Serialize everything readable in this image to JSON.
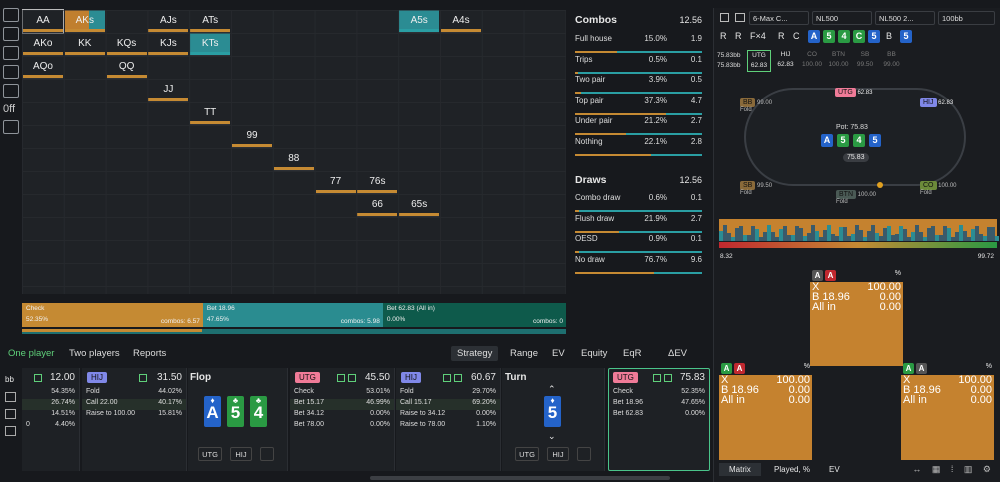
{
  "left_toolbar": {
    "icons": [
      "grid-icon",
      "copy-icon",
      "cards-icon",
      "chat-icon",
      "layout-icon",
      "0ff-icon",
      "message-icon"
    ],
    "zero_label": "0ff"
  },
  "matrix": {
    "cells": [
      {
        "label": "AA",
        "col": 0,
        "row": 0,
        "color": "#1f2226",
        "bar": "#c58a33",
        "selected": true
      },
      {
        "label": "AKs",
        "col": 1,
        "row": 0,
        "color": "#c07f2f",
        "bar": "#c58a33",
        "color2": "#2b8c93"
      },
      {
        "label": "AJs",
        "col": 3,
        "row": 0,
        "bar": "#c58a33"
      },
      {
        "label": "ATs",
        "col": 4,
        "row": 0,
        "bar": "#c58a33"
      },
      {
        "label": "A5s",
        "col": 9,
        "row": 0,
        "color": "#2b8c93",
        "bar": "#2a9ea3"
      },
      {
        "label": "A4s",
        "col": 10,
        "row": 0,
        "bar": "#c58a33"
      },
      {
        "label": "AKo",
        "col": 0,
        "row": 1,
        "bar": "#c58a33"
      },
      {
        "label": "KK",
        "col": 1,
        "row": 1,
        "bar": "#c58a33"
      },
      {
        "label": "KQs",
        "col": 2,
        "row": 1,
        "bar": "#c58a33"
      },
      {
        "label": "KJs",
        "col": 3,
        "row": 1,
        "bar": "#c58a33"
      },
      {
        "label": "KTs",
        "col": 4,
        "row": 1,
        "color": "#2b8c93",
        "bar": "#2a9ea3"
      },
      {
        "label": "AQo",
        "col": 0,
        "row": 2,
        "bar": "#c58a33"
      },
      {
        "label": "QQ",
        "col": 2,
        "row": 2,
        "bar": "#c58a33"
      },
      {
        "label": "JJ",
        "col": 3,
        "row": 3,
        "bar": "#c58a33"
      },
      {
        "label": "TT",
        "col": 4,
        "row": 4,
        "bar": "#c58a33"
      },
      {
        "label": "99",
        "col": 5,
        "row": 5,
        "bar": "#c58a33"
      },
      {
        "label": "88",
        "col": 6,
        "row": 6,
        "bar": "#c58a33"
      },
      {
        "label": "77",
        "col": 7,
        "row": 7,
        "bar": "#c58a33"
      },
      {
        "label": "76s",
        "col": 8,
        "row": 7,
        "bar": "#c58a33"
      },
      {
        "label": "66",
        "col": 8,
        "row": 8,
        "bar": "#c58a33"
      },
      {
        "label": "65s",
        "col": 9,
        "row": 8,
        "bar": "#c58a33"
      }
    ]
  },
  "action_bar": {
    "segments": [
      {
        "name": "Check",
        "pct": "52.35%",
        "combos": "combos: 6.57",
        "color": "#c58a33",
        "frac": 0.3325
      },
      {
        "name": "Bet 18.96",
        "pct": "47.65%",
        "combos": "combos: 5.98",
        "color": "#2a8c90",
        "frac": 0.3308
      },
      {
        "name": "Bet 62.83 (All in)",
        "pct": "0.00%",
        "combos": "combos: 0",
        "color": "#0e5a4b",
        "frac": 0.3367
      }
    ]
  },
  "combos_panel": {
    "combos_title": "Combos",
    "combos_total": "12.56",
    "combos": [
      {
        "name": "Full house",
        "pct": "15.0%",
        "val": "1.9",
        "fill": 0.33
      },
      {
        "name": "Trips",
        "pct": "0.5%",
        "val": "0.1",
        "fill": 0.02
      },
      {
        "name": "Two pair",
        "pct": "3.9%",
        "val": "0.5",
        "fill": 0.05
      },
      {
        "name": "Top pair",
        "pct": "37.3%",
        "val": "4.7",
        "fill": 0.72
      },
      {
        "name": "Under pair",
        "pct": "21.2%",
        "val": "2.7",
        "fill": 0.4
      },
      {
        "name": "Nothing",
        "pct": "22.1%",
        "val": "2.8",
        "fill": 0.6
      }
    ],
    "draws_title": "Draws",
    "draws_total": "12.56",
    "draws": [
      {
        "name": "Combo draw",
        "pct": "0.6%",
        "val": "0.1",
        "fill": 0.03
      },
      {
        "name": "Flush draw",
        "pct": "21.9%",
        "val": "2.7",
        "fill": 0.35
      },
      {
        "name": "OESD",
        "pct": "0.9%",
        "val": "0.1",
        "fill": 0.03
      },
      {
        "name": "No draw",
        "pct": "76.7%",
        "val": "9.6",
        "fill": 0.62
      }
    ]
  },
  "tabs": {
    "one_player": "One player",
    "two_players": "Two players",
    "reports": "Reports",
    "strategy": "Strategy",
    "range": "Range",
    "ev": "EV",
    "equity": "Equity",
    "eqr": "EqR",
    "dev": "ΔEV"
  },
  "cards": {
    "col0": {
      "value": "12.00",
      "rows": [
        {
          "l": "",
          "r": "54.35%"
        },
        {
          "l": "",
          "r": "26.74%"
        },
        {
          "l": "",
          "r": "14.51%"
        },
        {
          "l": "0",
          "r": "4.40%"
        }
      ]
    },
    "col1": {
      "tag": "HIJ",
      "value": "31.50",
      "rows": [
        {
          "l": "Fold",
          "r": "44.02%"
        },
        {
          "l": "Call 22.00",
          "r": "40.17%"
        },
        {
          "l": "Raise to 100.00",
          "r": "15.81%"
        }
      ]
    },
    "flop": {
      "title": "Flop",
      "cards": [
        {
          "rank": "A",
          "suit": "♦",
          "color": "#2463c9"
        },
        {
          "rank": "5",
          "suit": "♣",
          "color": "#2a9a43"
        },
        {
          "rank": "4",
          "suit": "♣",
          "color": "#2a9a43"
        }
      ],
      "btn1": "UTG",
      "btn2": "HIJ"
    },
    "col3": {
      "tag": "UTG",
      "value": "45.50",
      "rows": [
        {
          "l": "Check",
          "r": "53.01%"
        },
        {
          "l": "Bet 15.17",
          "r": "46.99%"
        },
        {
          "l": "Bet 34.12",
          "r": "0.00%"
        },
        {
          "l": "Bet 78.00",
          "r": "0.00%"
        }
      ]
    },
    "col4": {
      "tag": "HIJ",
      "value": "60.67",
      "rows": [
        {
          "l": "Fold",
          "r": "29.70%"
        },
        {
          "l": "Call 15.17",
          "r": "69.20%"
        },
        {
          "l": "Raise to 34.12",
          "r": "0.00%"
        },
        {
          "l": "Raise to 78.00",
          "r": "1.10%"
        }
      ]
    },
    "turn": {
      "title": "Turn",
      "card": {
        "rank": "5",
        "suit": "♦",
        "color": "#2463c9"
      },
      "btn1": "UTG",
      "btn2": "HIJ"
    },
    "col6": {
      "tag": "UTG",
      "value": "75.83",
      "rows": [
        {
          "l": "Check",
          "r": "52.35%"
        },
        {
          "l": "Bet 18.96",
          "r": "47.65%"
        },
        {
          "l": "Bet 62.83",
          "r": "0.00%"
        }
      ]
    }
  },
  "right": {
    "dropdowns": [
      "6-Max C...",
      "NL500",
      "NL500 2...",
      "100bb"
    ],
    "history": [
      "R",
      "R",
      "F×4",
      "R",
      "C"
    ],
    "board": [
      {
        "rank": "A",
        "color": "#2463c9"
      },
      {
        "rank": "5",
        "color": "#2a9a43"
      },
      {
        "rank": "4",
        "color": "#2a9a43"
      },
      {
        "rank": "C",
        "color": "#2a9a43"
      },
      {
        "rank": "5",
        "color": "#2463c9"
      }
    ],
    "board_last": "B",
    "stacks": {
      "main": "75.83bb",
      "main2": "75.83bb",
      "positions": [
        {
          "n": "UTG",
          "v": "62.83"
        },
        {
          "n": "HIJ",
          "v": "62.83"
        },
        {
          "n": "CO",
          "v": "100.00"
        },
        {
          "n": "BTN",
          "v": "100.00"
        },
        {
          "n": "SB",
          "v": "99.50"
        },
        {
          "n": "BB",
          "v": "99.00"
        }
      ]
    },
    "table": {
      "pot": "Pot: 75.83",
      "pot_value": "75.83",
      "utg": "UTG",
      "utg_v": "62.83",
      "hij": "HIJ",
      "hij_v": "62.83",
      "bb": "BB",
      "bb_v": "99.00",
      "bb_s": "Fold",
      "sb": "SB",
      "sb_v": "99.50",
      "sb_s": "Fold",
      "btn": "BTN",
      "btn_v": "100.00",
      "btn_s": "Fold",
      "co": "CO",
      "co_v": "100.00",
      "co_s": "Fold"
    },
    "eq_min": "8.32",
    "eq_max": "99.72",
    "freq_boxes": [
      {
        "cards": [
          {
            "r": "A",
            "c": "#555"
          },
          {
            "r": "A",
            "c": "#c0282f"
          }
        ],
        "pct": "%",
        "rows": [
          {
            "n": "X",
            "v": "100.00"
          },
          {
            "n": "B 18.96",
            "v": "0.00"
          },
          {
            "n": "All in",
            "v": "0.00"
          }
        ]
      },
      {
        "cards": [
          {
            "r": "A",
            "c": "#2a9a43"
          },
          {
            "r": "A",
            "c": "#c0282f"
          }
        ],
        "pct": "%",
        "rows": [
          {
            "n": "X",
            "v": "100.00"
          },
          {
            "n": "B 18.96",
            "v": "0.00"
          },
          {
            "n": "All in",
            "v": "0.00"
          }
        ]
      },
      {
        "cards": [
          {
            "r": "A",
            "c": "#2a9a43"
          },
          {
            "r": "A",
            "c": "#555"
          }
        ],
        "pct": "%",
        "rows": [
          {
            "n": "X",
            "v": "100.00"
          },
          {
            "n": "B 18.96",
            "v": "0.00"
          },
          {
            "n": "All in",
            "v": "0.00"
          }
        ]
      }
    ],
    "bottom_tabs": {
      "matrix": "Matrix",
      "played": "Played, %",
      "ev": "EV"
    }
  }
}
